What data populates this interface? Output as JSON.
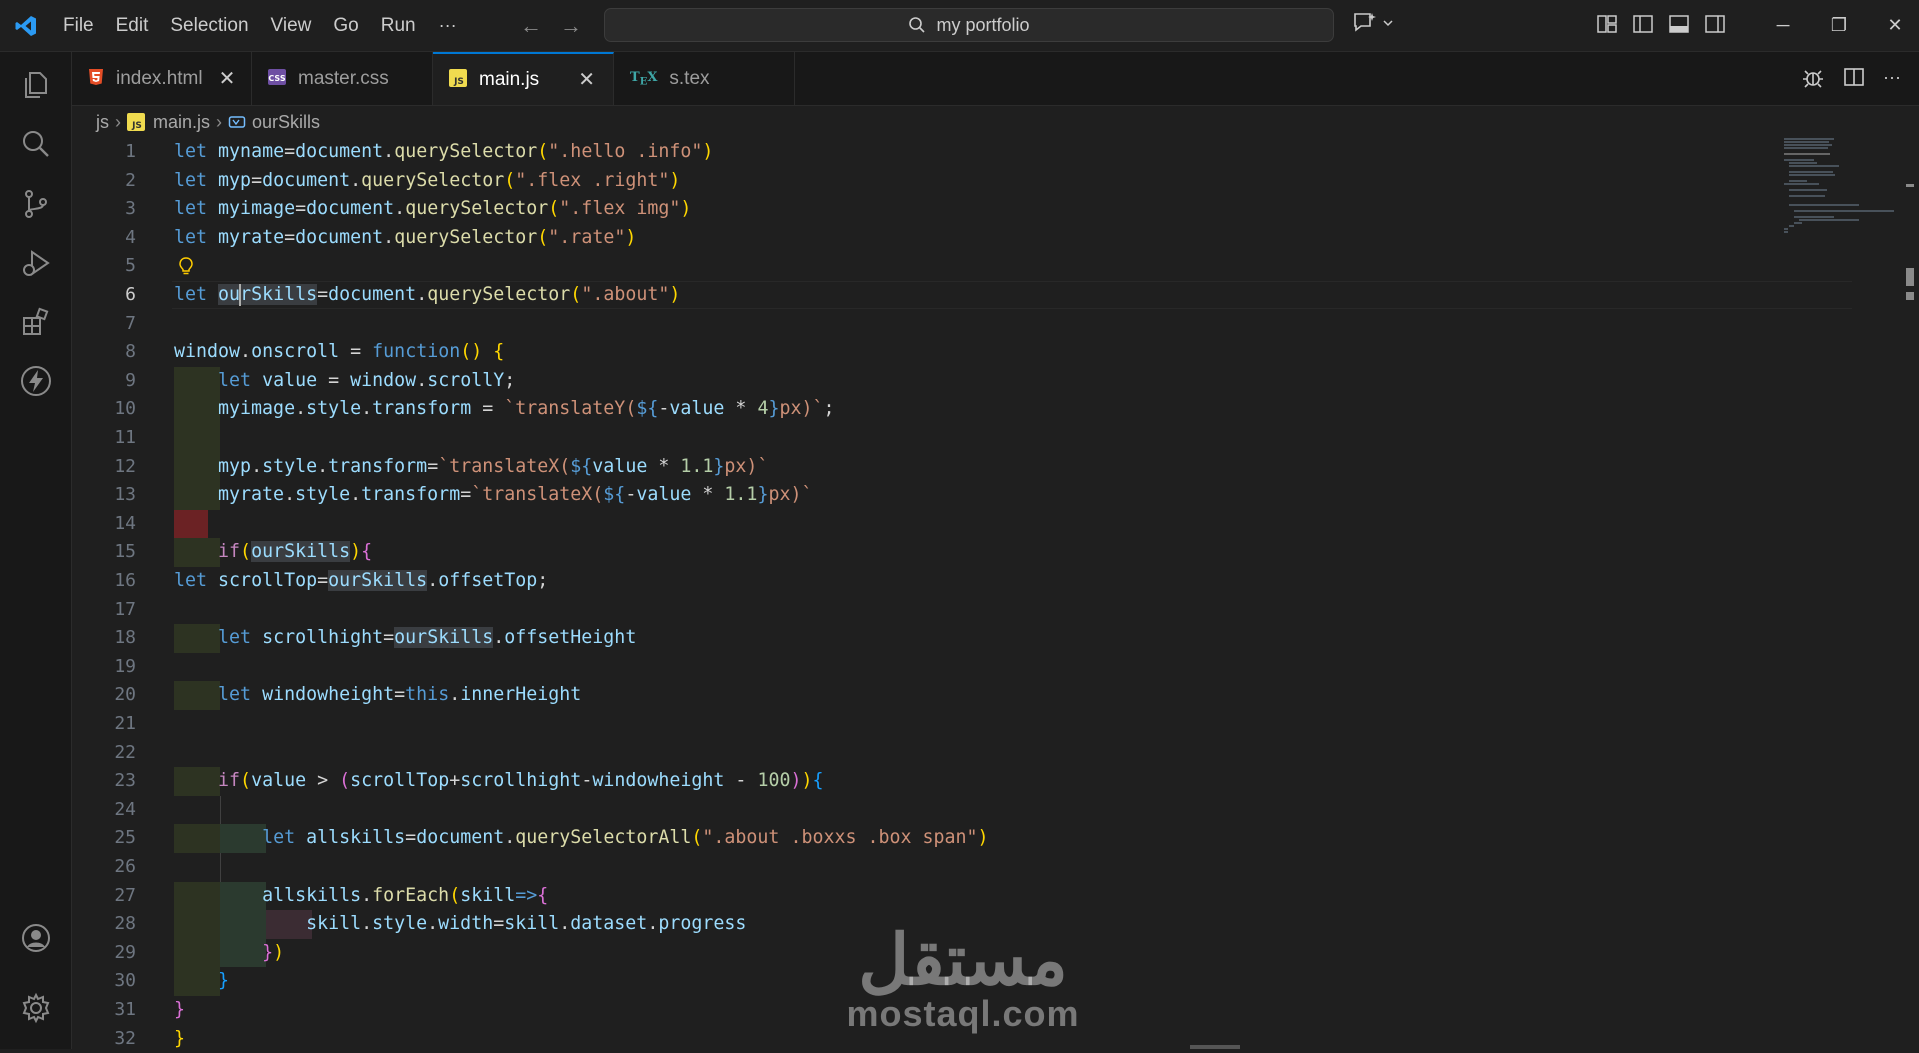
{
  "titlebar": {
    "menu": [
      "File",
      "Edit",
      "Selection",
      "View",
      "Go",
      "Run"
    ],
    "more": "···",
    "search_text": "my portfolio",
    "icons": [
      "vscode-logo-icon",
      "back-arrow-icon",
      "forward-arrow-icon",
      "search-icon",
      "copilot-icon",
      "layout-icon"
    ],
    "window_controls": [
      "─",
      "❐",
      "✕"
    ]
  },
  "tabs": [
    {
      "label": "index.html",
      "icon": "html5-icon",
      "color": "#e44d26",
      "active": false
    },
    {
      "label": "master.css",
      "icon": "css-icon",
      "color": "#8e6ec7",
      "active": false
    },
    {
      "label": "main.js",
      "icon": "js-icon",
      "color": "#f0db4f",
      "active": true
    },
    {
      "label": "s.tex",
      "icon": "tex-icon",
      "color": "#3fa7a7",
      "active": false
    }
  ],
  "breadcrumb": {
    "folder": "js",
    "file": "main.js",
    "symbol": "ourSkills"
  },
  "editor": {
    "line_numbers": [
      "1",
      "2",
      "3",
      "4",
      "5",
      "6",
      "7",
      "8",
      "9",
      "10",
      "11",
      "12",
      "13",
      "14",
      "15",
      "16",
      "17",
      "18",
      "19",
      "20",
      "21",
      "22",
      "23",
      "24",
      "25",
      "26",
      "27",
      "28",
      "29",
      "30",
      "31",
      "32"
    ],
    "current_line": 6
  },
  "watermark": {
    "arabic": "مستقل",
    "latin": "mostaql.com"
  },
  "colors": {
    "accent": "#0078d4",
    "editor_bg": "#1f1f1f",
    "sidebar_bg": "#181818"
  }
}
